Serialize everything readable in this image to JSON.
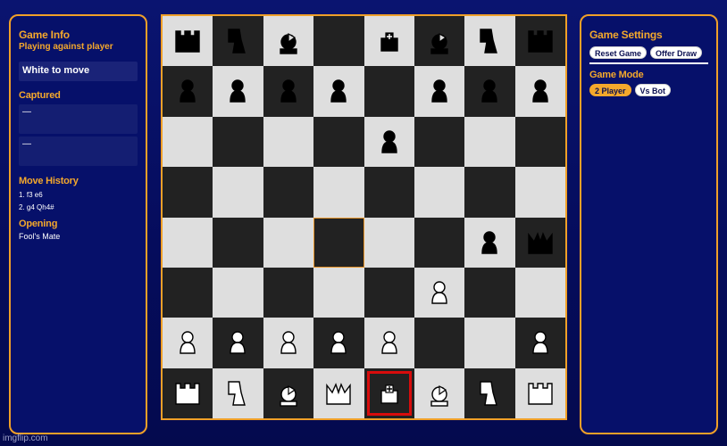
{
  "left_panel": {
    "title": "Game Info",
    "opponent": "Playing against player",
    "status": "White to move",
    "captured_label": "Captured",
    "captured": [
      "—",
      "—"
    ],
    "history_label": "Move History",
    "history": [
      "1. f3 e6",
      "2. g4 Qh4#"
    ],
    "opening_label": "Opening",
    "opening": "Fool's Mate"
  },
  "right_panel": {
    "title": "Game Settings",
    "reset_label": "Reset Game",
    "draw_label": "Offer Draw",
    "mode_label": "Game Mode",
    "mode_options": [
      "2 Player",
      "Vs Bot"
    ],
    "mode_selected": "2 Player"
  },
  "board": {
    "rows": [
      [
        "bR",
        "bN",
        "bB",
        "",
        "bK",
        "bB",
        "bN",
        "bR"
      ],
      [
        "bP",
        "bP",
        "bP",
        "bP",
        "",
        "bP",
        "bP",
        "bP"
      ],
      [
        "",
        "",
        "",
        "",
        "bP",
        "",
        "",
        ""
      ],
      [
        "",
        "",
        "",
        "",
        "",
        "",
        "",
        ""
      ],
      [
        "",
        "",
        "",
        "",
        "",
        "",
        "bP",
        "bQ"
      ],
      [
        "",
        "",
        "",
        "",
        "",
        "wP",
        "",
        ""
      ],
      [
        "wP",
        "wP",
        "wP",
        "wP",
        "wP",
        "",
        "",
        "wP"
      ],
      [
        "wR",
        "wN",
        "wB",
        "wQ",
        "wK",
        "wB",
        "wN",
        "wR"
      ]
    ],
    "highlight_last_move": [
      4,
      3
    ],
    "highlight_check": [
      7,
      4
    ]
  },
  "colors": {
    "light_square": "#dedede",
    "dark_square": "#222222",
    "accent": "#f4a82c",
    "check": "#d80c0c"
  },
  "watermark": "imgflip.com"
}
